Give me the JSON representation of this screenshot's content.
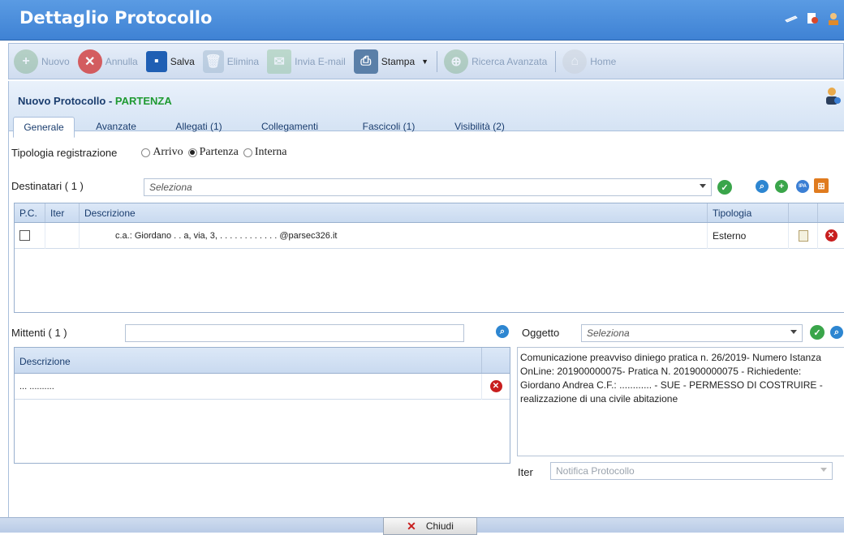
{
  "window": {
    "title": "Dettaglio Protocollo"
  },
  "toolbar": {
    "nuovo": "Nuovo",
    "annulla": "Annulla",
    "salva": "Salva",
    "elimina": "Elimina",
    "invia_email": "Invia E-mail",
    "stampa": "Stampa",
    "ricerca_avanzata": "Ricerca Avanzata",
    "home": "Home"
  },
  "header": {
    "title_prefix": "Nuovo Protocollo - ",
    "title_type": "PARTENZA"
  },
  "tabs": [
    {
      "label": "Generale"
    },
    {
      "label": "Avanzate"
    },
    {
      "label": "Allegati (1)"
    },
    {
      "label": "Collegamenti"
    },
    {
      "label": "Fascicoli (1)"
    },
    {
      "label": "Visibilità (2)"
    }
  ],
  "tipologia": {
    "label": "Tipologia registrazione",
    "options": [
      "Arrivo",
      "Partenza",
      "Interna"
    ],
    "selected": "Partenza"
  },
  "destinatari": {
    "label": "Destinatari ( 1 )",
    "placeholder": "Seleziona",
    "columns": [
      "P.C.",
      "Iter",
      "Descrizione",
      "Tipologia"
    ],
    "rows": [
      {
        "descrizione": "c.a.: Giordano . . a, via, 3, . . . . . . . . . . . . @parsec326.it",
        "tipologia": "Esterno"
      }
    ]
  },
  "mittenti": {
    "label": "Mittenti ( 1 )",
    "columns": [
      "Descrizione"
    ],
    "rows": [
      {
        "descrizione": "... .........."
      }
    ]
  },
  "oggetto": {
    "label": "Oggetto",
    "placeholder": "Seleziona",
    "text": "Comunicazione preavviso diniego pratica n. 26/2019- Numero Istanza OnLine: 201900000075- Pratica N. 201900000075 - Richiedente: Giordano Andrea C.F.: ............ - SUE - PERMESSO DI COSTRUIRE - realizzazione di una civile abitazione"
  },
  "iter": {
    "label": "Iter",
    "value": "Notifica Protocollo"
  },
  "footer": {
    "chiudi": "Chiudi"
  }
}
